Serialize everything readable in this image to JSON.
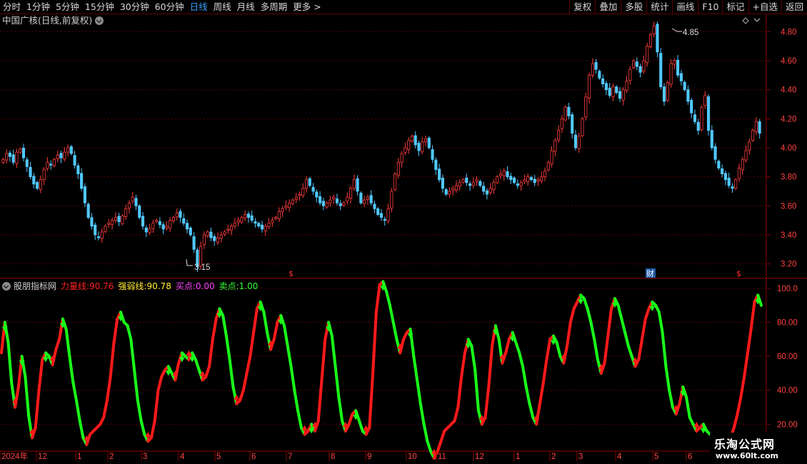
{
  "toolbar": {
    "periods": [
      "分时",
      "1分钟",
      "5分钟",
      "15分钟",
      "30分钟",
      "60分钟",
      "日线",
      "周线",
      "月线",
      "多周期",
      "更多 >"
    ],
    "active_period": "日线",
    "buttons": [
      "复权",
      "叠加",
      "多股",
      "统计",
      "画线",
      "F10",
      "标记",
      "+自选",
      "返回"
    ]
  },
  "main_chart": {
    "title": "中国广核(日线,前复权)",
    "high_label": "4.85",
    "low_label": "3.15",
    "y_ticks": [
      "4.80",
      "4.60",
      "4.40",
      "4.20",
      "4.00",
      "3.80",
      "3.60",
      "3.40",
      "3.20"
    ],
    "markers": [
      "$",
      "财",
      "$"
    ],
    "colors": {
      "up": "#ff3c3c",
      "down": "#50c8ff",
      "grid": "#5a0000"
    },
    "series_close": [
      3.92,
      3.96,
      3.94,
      3.9,
      3.97,
      3.99,
      3.93,
      3.87,
      3.8,
      3.75,
      3.72,
      3.78,
      3.85,
      3.9,
      3.88,
      3.92,
      3.95,
      3.93,
      3.97,
      4.0,
      3.96,
      3.88,
      3.82,
      3.72,
      3.62,
      3.52,
      3.46,
      3.4,
      3.38,
      3.42,
      3.46,
      3.48,
      3.5,
      3.52,
      3.49,
      3.53,
      3.58,
      3.62,
      3.66,
      3.6,
      3.52,
      3.46,
      3.42,
      3.44,
      3.48,
      3.5,
      3.47,
      3.44,
      3.46,
      3.5,
      3.52,
      3.55,
      3.52,
      3.48,
      3.44,
      3.4,
      3.3,
      3.18,
      3.32,
      3.4,
      3.42,
      3.38,
      3.36,
      3.38,
      3.4,
      3.42,
      3.44,
      3.46,
      3.48,
      3.5,
      3.52,
      3.54,
      3.52,
      3.5,
      3.48,
      3.46,
      3.44,
      3.46,
      3.48,
      3.5,
      3.52,
      3.56,
      3.58,
      3.6,
      3.62,
      3.64,
      3.66,
      3.68,
      3.72,
      3.78,
      3.74,
      3.7,
      3.66,
      3.62,
      3.6,
      3.62,
      3.64,
      3.66,
      3.62,
      3.6,
      3.62,
      3.66,
      3.72,
      3.78,
      3.7,
      3.62,
      3.64,
      3.66,
      3.62,
      3.58,
      3.54,
      3.52,
      3.5,
      3.58,
      3.7,
      3.82,
      3.9,
      3.96,
      4.0,
      4.05,
      4.08,
      4.02,
      3.98,
      4.04,
      4.06,
      4.0,
      3.92,
      3.85,
      3.78,
      3.72,
      3.68,
      3.7,
      3.72,
      3.74,
      3.76,
      3.78,
      3.76,
      3.74,
      3.76,
      3.78,
      3.74,
      3.7,
      3.68,
      3.72,
      3.76,
      3.8,
      3.82,
      3.84,
      3.8,
      3.78,
      3.76,
      3.74,
      3.76,
      3.78,
      3.8,
      3.78,
      3.76,
      3.78,
      3.8,
      3.84,
      3.9,
      3.98,
      4.05,
      4.12,
      4.2,
      4.28,
      4.22,
      4.1,
      4.0,
      4.08,
      4.2,
      4.35,
      4.5,
      4.58,
      4.54,
      4.48,
      4.44,
      4.4,
      4.36,
      4.42,
      4.38,
      4.34,
      4.4,
      4.46,
      4.54,
      4.6,
      4.56,
      4.52,
      4.6,
      4.7,
      4.78,
      4.84,
      4.66,
      4.42,
      4.32,
      4.45,
      4.58,
      4.6,
      4.5,
      4.46,
      4.4,
      4.32,
      4.24,
      4.18,
      4.12,
      4.28,
      4.36,
      4.12,
      4.0,
      3.92,
      3.86,
      3.82,
      3.78,
      3.74,
      3.72,
      3.78,
      3.86,
      3.92,
      3.98,
      4.04,
      4.12,
      4.18,
      4.1
    ]
  },
  "indicator": {
    "name": "股朋指标网",
    "lines": [
      {
        "label": "力量线: ",
        "value": "90.76",
        "color": "#ff2020"
      },
      {
        "label": "强弱线: ",
        "value": "90.78",
        "color": "#ffee33"
      },
      {
        "label": "买点: ",
        "value": "0.00",
        "color": "#ff44ff"
      },
      {
        "label": "卖点: ",
        "value": "1.00",
        "color": "#33ff33"
      }
    ],
    "y_ticks": [
      "100.0",
      "80.00",
      "60.00",
      "40.00",
      "20.00"
    ],
    "y_range": [
      5,
      105
    ],
    "colors": {
      "rising": "#ff1a1a",
      "falling": "#19ff19"
    },
    "series": [
      62,
      80,
      68,
      44,
      30,
      42,
      60,
      48,
      25,
      12,
      18,
      40,
      58,
      62,
      60,
      55,
      64,
      70,
      82,
      76,
      60,
      45,
      34,
      22,
      12,
      8,
      14,
      16,
      18,
      20,
      24,
      34,
      48,
      68,
      82,
      86,
      80,
      78,
      70,
      52,
      34,
      22,
      14,
      10,
      12,
      22,
      40,
      48,
      52,
      54,
      50,
      46,
      56,
      62,
      60,
      58,
      62,
      58,
      52,
      46,
      48,
      54,
      70,
      82,
      88,
      84,
      72,
      58,
      42,
      32,
      34,
      40,
      50,
      60,
      74,
      88,
      92,
      86,
      74,
      64,
      70,
      80,
      84,
      78,
      66,
      54,
      40,
      28,
      18,
      14,
      16,
      20,
      16,
      22,
      46,
      70,
      80,
      72,
      54,
      36,
      22,
      16,
      20,
      26,
      28,
      22,
      16,
      14,
      18,
      50,
      86,
      102,
      104,
      98,
      90,
      80,
      70,
      62,
      70,
      74,
      76,
      60,
      46,
      32,
      20,
      10,
      4,
      0,
      4,
      10,
      16,
      18,
      20,
      22,
      30,
      48,
      62,
      70,
      66,
      52,
      28,
      20,
      24,
      42,
      66,
      78,
      70,
      56,
      62,
      70,
      74,
      68,
      62,
      54,
      42,
      32,
      24,
      20,
      32,
      44,
      58,
      70,
      72,
      68,
      60,
      56,
      66,
      80,
      88,
      92,
      96,
      94,
      88,
      80,
      70,
      58,
      50,
      56,
      72,
      88,
      94,
      90,
      82,
      74,
      66,
      60,
      54,
      58,
      70,
      82,
      88,
      92,
      90,
      86,
      74,
      54,
      40,
      30,
      26,
      32,
      42,
      36,
      24,
      20,
      16,
      18,
      20,
      16,
      14,
      12,
      10,
      8,
      6,
      8,
      12,
      18,
      26,
      36,
      48,
      62,
      76,
      92,
      96,
      90
    ]
  },
  "timeline": {
    "labels": [
      "2024年",
      "12",
      "1",
      "2",
      "3",
      "4",
      "5",
      "6",
      "7",
      "8",
      "9",
      "10",
      "11",
      "12",
      "1",
      "2",
      "3",
      "4",
      "5",
      "6"
    ]
  },
  "watermark": {
    "main": "乐淘公式网",
    "sub": "www.60lt.com"
  }
}
